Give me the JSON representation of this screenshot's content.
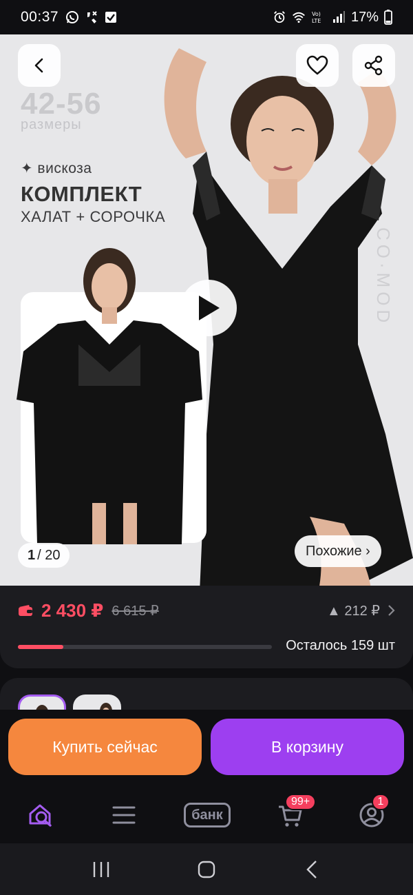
{
  "status_bar": {
    "time": "00:37",
    "battery": "17%",
    "left_icons": [
      "whatsapp-icon",
      "missed-call-icon",
      "checkbox-icon"
    ],
    "right_icons": [
      "alarm-icon",
      "wifi-icon",
      "volte-icon",
      "signal-icon",
      "battery-icon"
    ]
  },
  "gallery": {
    "sizes": "42-56",
    "sizes_label": "размеры",
    "fabric": "✦ вискоза",
    "title": "КОМПЛЕКТ",
    "subtitle": "ХАЛАТ + СОРОЧКА",
    "brand": "CO·MOD",
    "counter_current": "1",
    "counter_total": "/ 20",
    "similar_label": "Похожие ›"
  },
  "price": {
    "current": "2 430 ₽",
    "old": "6 615 ₽",
    "delta": "▲ 212 ₽",
    "stock_label": "Осталось 159 шт",
    "stock_progress": 0.18,
    "accent": "#ff4e63"
  },
  "actions": {
    "buy_now": "Купить сейчас",
    "add_to_cart": "В корзину",
    "buy_color": "#f5873e",
    "cart_color": "#9d3ff0"
  },
  "bottom_nav": {
    "bank_label": "банк",
    "cart_badge": "99+",
    "profile_badge": "1"
  }
}
